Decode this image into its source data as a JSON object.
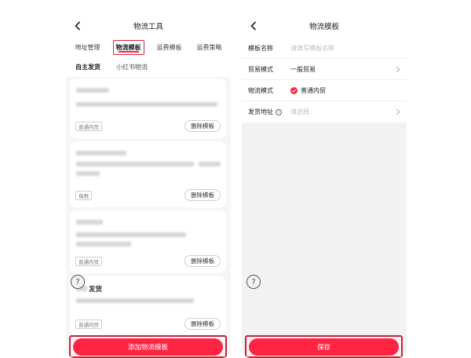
{
  "left": {
    "title": "物流工具",
    "tabs": [
      "地址管理",
      "物流模板",
      "运费模板",
      "运费策略"
    ],
    "subtabs": [
      "自主发货",
      "小红书物流"
    ],
    "cards": [
      {
        "tag": "普通内贸",
        "delete_label": "删除模板"
      },
      {
        "tag": "保税",
        "delete_label": "删除模板"
      },
      {
        "tag": "普通内贸",
        "delete_label": "删除模板"
      },
      {
        "title_visible": "发货",
        "tag": "普通内贸",
        "delete_label": "删除模板"
      }
    ],
    "add_button": "添加物流模板"
  },
  "right": {
    "title": "物流模板",
    "form": {
      "name_label": "模板名称",
      "name_placeholder": "请填写模板名称",
      "trade_label": "贸易模式",
      "trade_value": "一般贸易",
      "logistics_label": "物流模式",
      "logistics_value": "普通内贸",
      "address_label": "发货地址",
      "address_placeholder": "请选择"
    },
    "save_button": "保存"
  },
  "icons": {
    "back": "chevron-left-icon",
    "help": "question-circle-icon",
    "info": "info-circle-icon",
    "check": "check-circle-icon",
    "chevron": "chevron-right-icon"
  },
  "colors": {
    "accent": "#ff2442",
    "highlight_frame": "#c6203a",
    "page_bg": "#f6f6f6"
  }
}
